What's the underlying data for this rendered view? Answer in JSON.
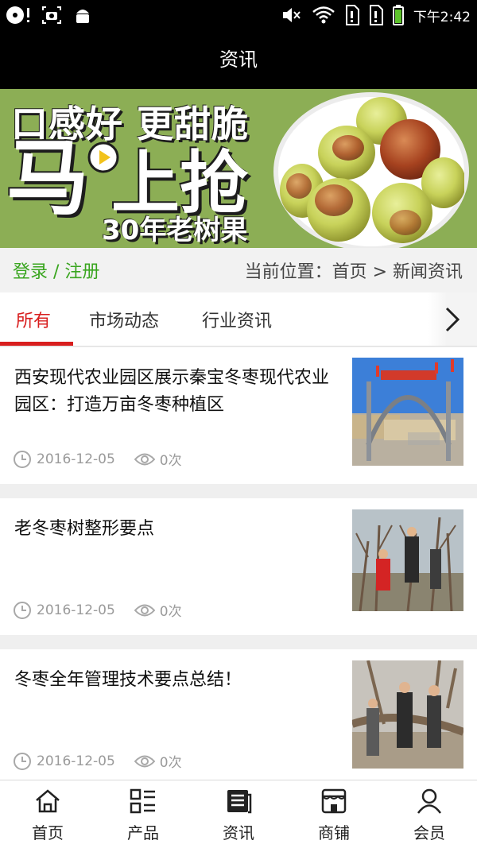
{
  "status_bar": {
    "time": "下午2:42",
    "icons": [
      "disc-icon",
      "screenshot-icon",
      "android-icon",
      "mute-icon",
      "wifi-icon",
      "sim1-icon",
      "sim2-icon",
      "battery-icon"
    ]
  },
  "header": {
    "title": "资讯"
  },
  "banner": {
    "line1": "口感好 更甜脆",
    "line2_a": "马",
    "line2_b": "上抢",
    "line3": "30年老树果"
  },
  "auth": {
    "login_label": "登录 / 注册"
  },
  "breadcrumb": {
    "text": "当前位置：首页 > 新闻资讯"
  },
  "tabs": [
    {
      "label": "所有",
      "active": true
    },
    {
      "label": "市场动态",
      "active": false
    },
    {
      "label": "行业资讯",
      "active": false
    }
  ],
  "news": [
    {
      "title": "西安现代农业园区展示秦宝冬枣现代农业园区：打造万亩冬枣种植区",
      "date": "2016-12-05",
      "views": "0次"
    },
    {
      "title": "老冬枣树整形要点",
      "date": "2016-12-05",
      "views": "0次"
    },
    {
      "title": "冬枣全年管理技术要点总结！",
      "date": "2016-12-05",
      "views": "0次"
    }
  ],
  "bottom_nav": [
    {
      "label": "首页",
      "icon": "home-icon"
    },
    {
      "label": "产品",
      "icon": "grid-list-icon"
    },
    {
      "label": "资讯",
      "icon": "news-icon",
      "active": true
    },
    {
      "label": "商铺",
      "icon": "shop-icon"
    },
    {
      "label": "会员",
      "icon": "user-icon"
    }
  ],
  "colors": {
    "accent_red": "#d81e1e",
    "login_green": "#39a51f",
    "banner_green": "#8cae55",
    "header_bg": "#000000"
  }
}
